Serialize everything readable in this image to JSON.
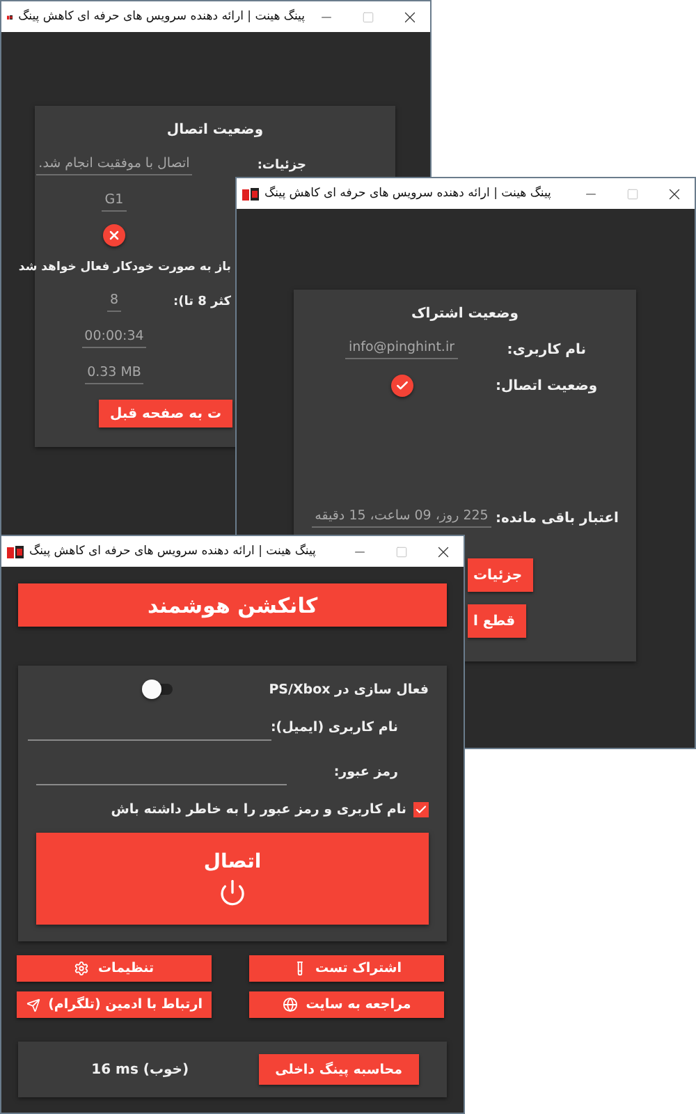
{
  "status_window": {
    "title": "پینگ هینت | ارائه دهنده سرویس های حرفه ای کاهش پینگ",
    "heading": "وضعیت اتصال",
    "rows": [
      {
        "kind": "field",
        "label": "جزئیات:",
        "value": "اتصال با موفقیت انجام شد."
      },
      {
        "kind": "field",
        "value": "G1"
      },
      {
        "kind": "status",
        "connected": false
      },
      {
        "kind": "note",
        "text": "باز به صورت خودکار فعال خواهد شد"
      },
      {
        "kind": "field",
        "label": "کثر 8 تا):",
        "value": "8"
      },
      {
        "kind": "field",
        "value": "00:00:34"
      },
      {
        "kind": "field",
        "value": "0.33 MB"
      }
    ],
    "button": "ت به صفحه قبل"
  },
  "subscription_window": {
    "title": "پینگ هینت | ارائه دهنده سرویس های حرفه ای کاهش پینگ",
    "heading": "وضعیت اشتراک",
    "rows": [
      {
        "kind": "field",
        "label": "نام کاربری:",
        "value": "info@pinghint.ir"
      },
      {
        "kind": "status",
        "label": "وضعیت اتصال:",
        "connected": true
      },
      {
        "kind": "field",
        "label": "اعتبار باقی مانده:",
        "value": "225 روز، 09 ساعت، 15 دقیقه"
      }
    ],
    "buttons": [
      "جزئیات",
      "قطع ا"
    ]
  },
  "main_window": {
    "title": "پینگ هینت | ارائه دهنده سرویس های حرفه ای کاهش پینگ",
    "header": "کانکشن هوشمند",
    "login": {
      "ps_xbox": {
        "label": "فعال سازی در PS/Xbox",
        "on": false
      },
      "email": {
        "label": "نام کاربری (ایمیل):"
      },
      "password": {
        "label": "رمز عبور:"
      },
      "remember": {
        "label": "نام کاربری و رمز عبور را به خاطر داشته باش",
        "checked": true
      },
      "connect": "اتصال"
    },
    "actions": [
      {
        "label": "اشتراک تست",
        "kind": "test"
      },
      {
        "label": "تنظیمات",
        "kind": "settings"
      },
      {
        "label": "مراجعه به سایت",
        "kind": "globe"
      },
      {
        "label": "ارتباط با ادمین (تلگرام)",
        "kind": "telegram"
      }
    ],
    "ping": {
      "button": "محاسبه پینگ داخلی",
      "result": "16 ms (خوب)"
    }
  }
}
